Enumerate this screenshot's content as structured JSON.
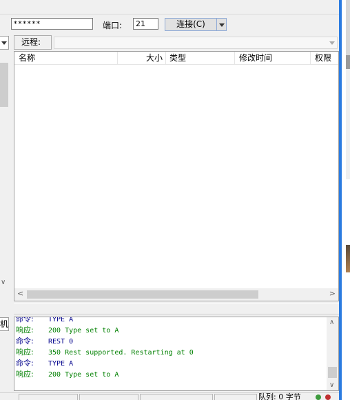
{
  "connection": {
    "password": "******",
    "port_label": "端口:",
    "port": "21",
    "connect_label": "连接(C)"
  },
  "remote": {
    "label": "远程:",
    "path": ""
  },
  "left_panel": {
    "label_fragment": "机"
  },
  "file_list": {
    "columns": [
      "名称",
      "大小",
      "类型",
      "修改时间",
      "权限"
    ],
    "rows": []
  },
  "log": {
    "lines": [
      {
        "kind": "命令:",
        "text": "TYPE A",
        "color": "#00008b"
      },
      {
        "kind": "响应:",
        "text": "200 Type set to A",
        "color": "#008000"
      },
      {
        "kind": "命令:",
        "text": "REST 0",
        "color": "#00008b"
      },
      {
        "kind": "响应:",
        "text": "350 Rest supported. Restarting at 0",
        "color": "#008000"
      },
      {
        "kind": "命令:",
        "text": "TYPE A",
        "color": "#00008b"
      },
      {
        "kind": "响应:",
        "text": "200 Type set to A",
        "color": "#008000"
      }
    ]
  },
  "status": {
    "queue_text": "队列: 0 字节"
  },
  "colors": {
    "command": "#00008b",
    "response": "#008000",
    "accent": "#2a7be0"
  }
}
